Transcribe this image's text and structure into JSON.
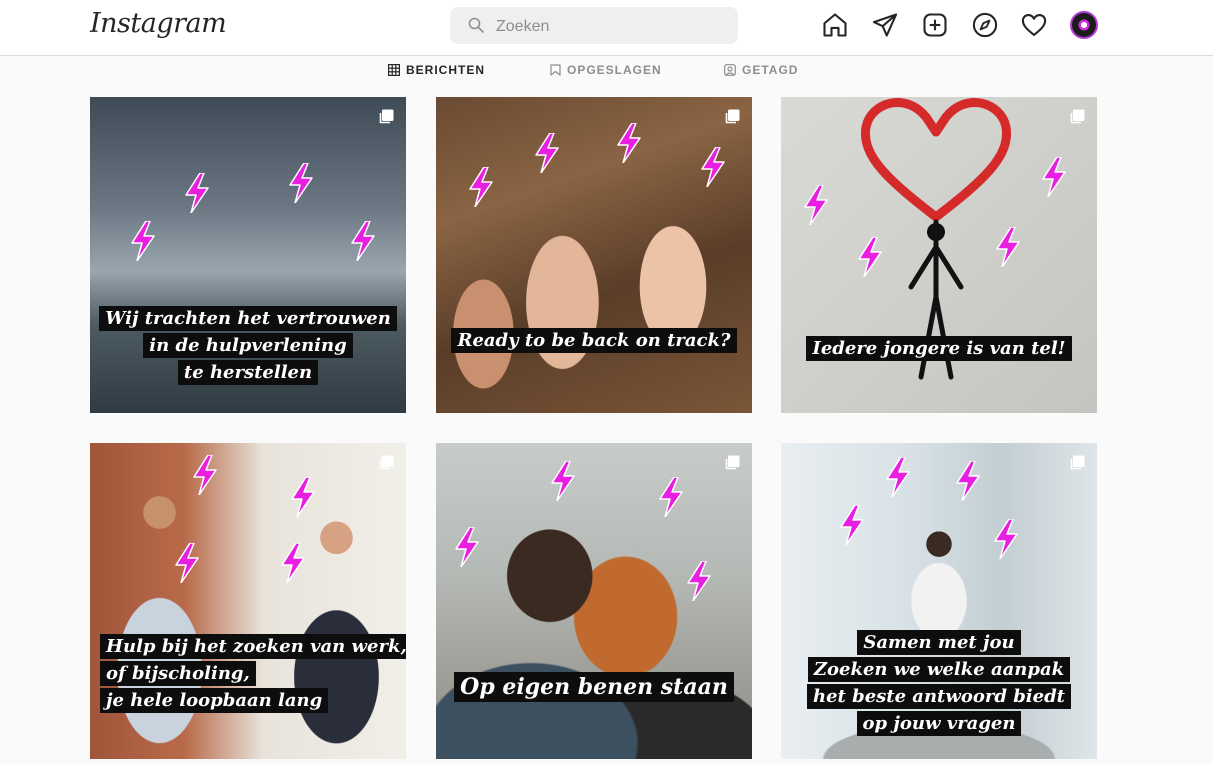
{
  "header": {
    "logo": "Instagram",
    "search": {
      "placeholder": "Zoeken"
    },
    "nav": [
      "home-icon",
      "direct-message-icon",
      "new-post-icon",
      "explore-icon",
      "activity-heart-icon",
      "profile-avatar"
    ]
  },
  "tabs": [
    {
      "label": "BERICHTEN",
      "icon": "grid-icon",
      "active": true
    },
    {
      "label": "OPGESLAGEN",
      "icon": "bookmark-icon",
      "active": false
    },
    {
      "label": "GETAGD",
      "icon": "tagged-icon",
      "active": false
    }
  ],
  "posts": [
    {
      "lines": [
        "Wij trachten het vertrouwen",
        "in de hulpverlening",
        "te herstellen"
      ],
      "multi": true
    },
    {
      "lines": [
        "Ready to be back on track?"
      ],
      "multi": true
    },
    {
      "lines": [
        "Iedere jongere is van tel!"
      ],
      "multi": true
    },
    {
      "lines": [
        "Hulp bij het zoeken van werk,",
        "of bijscholing,",
        "je hele loopbaan lang"
      ],
      "multi": true
    },
    {
      "lines": [
        "Op eigen benen staan"
      ],
      "multi": true
    },
    {
      "lines": [
        "Samen met jou",
        "Zoeken we welke aanpak",
        "het beste antwoord biedt",
        "op jouw vragen"
      ],
      "multi": true
    }
  ],
  "colors": {
    "accent_bolt": "#e81ee0",
    "caption_bg": "#0d0d0d",
    "border": "#dbdbdb"
  }
}
